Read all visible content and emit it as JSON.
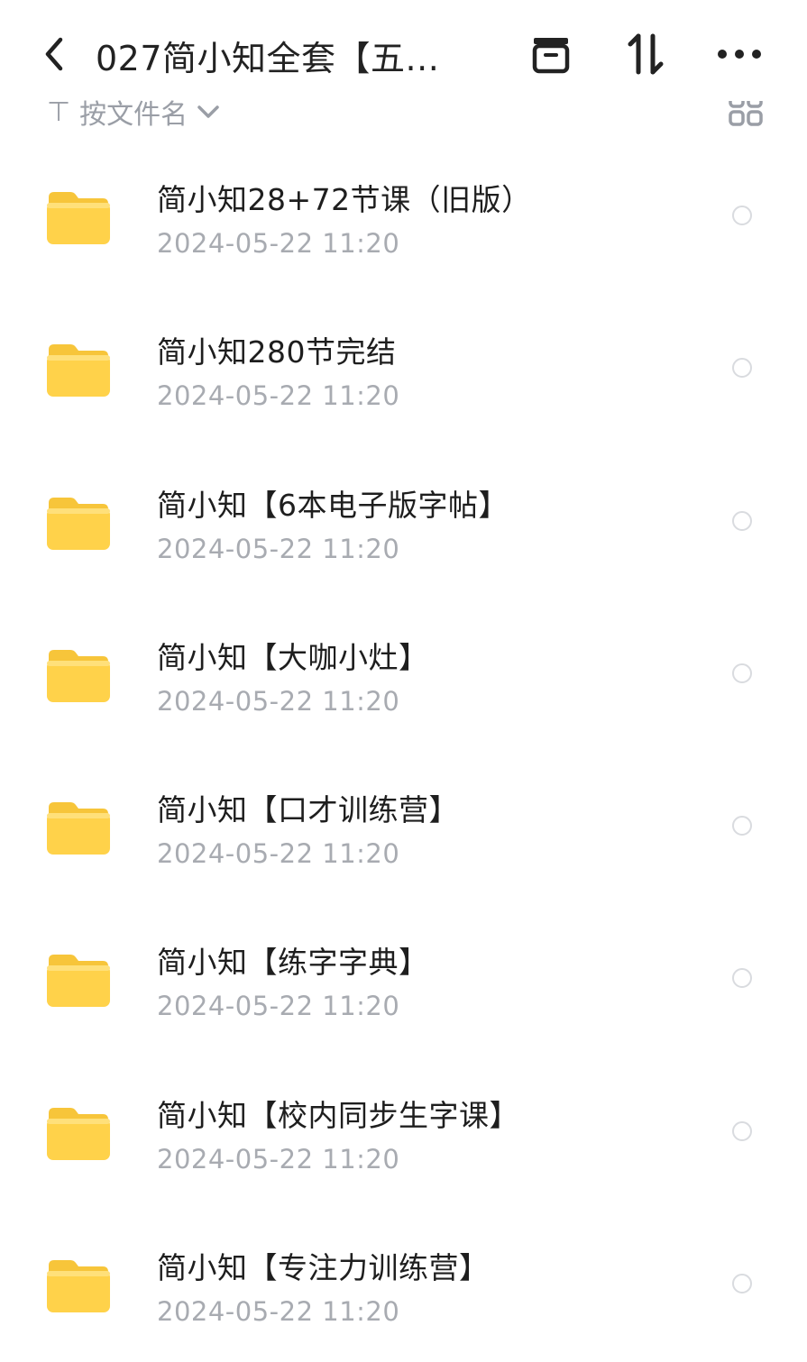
{
  "header": {
    "title": "027简小知全套【五...",
    "icons": [
      "back-icon",
      "archive-icon",
      "sort-arrows-icon",
      "more-icon"
    ]
  },
  "sortbar": {
    "label": "按文件名",
    "view_icon": "grid-view-icon"
  },
  "colors": {
    "folder": "#FFD24A",
    "folder_tab": "#F7C53A",
    "date_text": "#A8ABB1",
    "check_border": "#D9DBDF"
  },
  "files": [
    {
      "name": "简小知28+72节课（旧版）",
      "date": "2024-05-22  11:20"
    },
    {
      "name": "简小知280节完结",
      "date": "2024-05-22  11:20"
    },
    {
      "name": "简小知【6本电子版字帖】",
      "date": "2024-05-22  11:20"
    },
    {
      "name": "简小知【大咖小灶】",
      "date": "2024-05-22  11:20"
    },
    {
      "name": "简小知【口才训练营】",
      "date": "2024-05-22  11:20"
    },
    {
      "name": "简小知【练字字典】",
      "date": "2024-05-22  11:20"
    },
    {
      "name": "简小知【校内同步生字课】",
      "date": "2024-05-22  11:20"
    },
    {
      "name": "简小知【专注力训练营】",
      "date": "2024-05-22  11:20"
    }
  ]
}
